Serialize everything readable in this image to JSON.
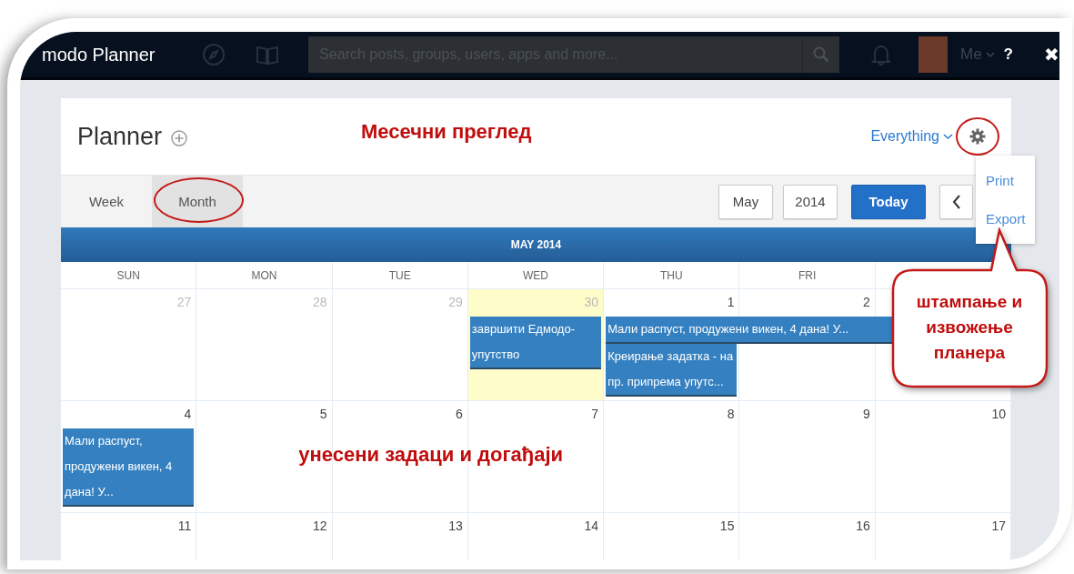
{
  "app_bar": {
    "brand": "modo Planner",
    "search": {
      "placeholder": "Search posts, groups, users, apps and more..."
    },
    "user": "Me",
    "help": "?",
    "close": "✖"
  },
  "planner": {
    "title": "Planner",
    "filter": "Everything",
    "menu": [
      {
        "label": "Print"
      },
      {
        "label": "Export"
      }
    ],
    "views": [
      {
        "label": "Week",
        "selected": false
      },
      {
        "label": "Month",
        "selected": true
      }
    ],
    "month": "May",
    "year": "2014",
    "today_button": "Today"
  },
  "calendar": {
    "title": "MAY 2014",
    "weekdays": [
      "SUN",
      "MON",
      "TUE",
      "WED",
      "THU",
      "FRI"
    ],
    "weeks": [
      {
        "days": [
          {
            "date": "27",
            "other_month": true,
            "today": false
          },
          {
            "date": "28",
            "other_month": true,
            "today": false
          },
          {
            "date": "29",
            "other_month": true,
            "today": false
          },
          {
            "date": "30",
            "other_month": true,
            "today": true,
            "events": [
              {
                "kind": "day",
                "title": "завршити Едмодо-упутство"
              }
            ]
          },
          {
            "date": "1",
            "other_month": false,
            "today": false,
            "events": [
              {
                "kind": "week-span",
                "title": "Мали распуст, продужени викен, 4 дана! У..."
              },
              {
                "kind": "day",
                "title": "Креирање задатка - на пр. припрема упутс..."
              }
            ]
          },
          {
            "date": "2",
            "other_month": false,
            "today": false
          }
        ]
      },
      {
        "days": [
          {
            "date": "4",
            "other_month": false,
            "today": false,
            "events": [
              {
                "kind": "day",
                "title": "Мали распуст, продужени викен, 4 дана! У..."
              }
            ]
          },
          {
            "date": "5",
            "other_month": false,
            "today": false
          },
          {
            "date": "6",
            "other_month": false,
            "today": false
          },
          {
            "date": "7",
            "other_month": false,
            "today": false
          },
          {
            "date": "8",
            "other_month": false,
            "today": false
          },
          {
            "date": "9",
            "other_month": false,
            "today": false
          },
          {
            "date": "10",
            "other_month": false,
            "today": false
          }
        ]
      },
      {
        "days": [
          {
            "date": "11",
            "other_month": false,
            "today": false
          },
          {
            "date": "12",
            "other_month": false,
            "today": false
          },
          {
            "date": "13",
            "other_month": false,
            "today": false
          },
          {
            "date": "14",
            "other_month": false,
            "today": false
          },
          {
            "date": "15",
            "other_month": false,
            "today": false
          },
          {
            "date": "16",
            "other_month": false,
            "today": false
          },
          {
            "date": "17",
            "other_month": false,
            "today": false
          }
        ]
      }
    ]
  },
  "annotations": {
    "heading": "Месечни преглед",
    "callout": "штампање и извожење планера",
    "events_note": "унесени задаци и догађаји"
  }
}
